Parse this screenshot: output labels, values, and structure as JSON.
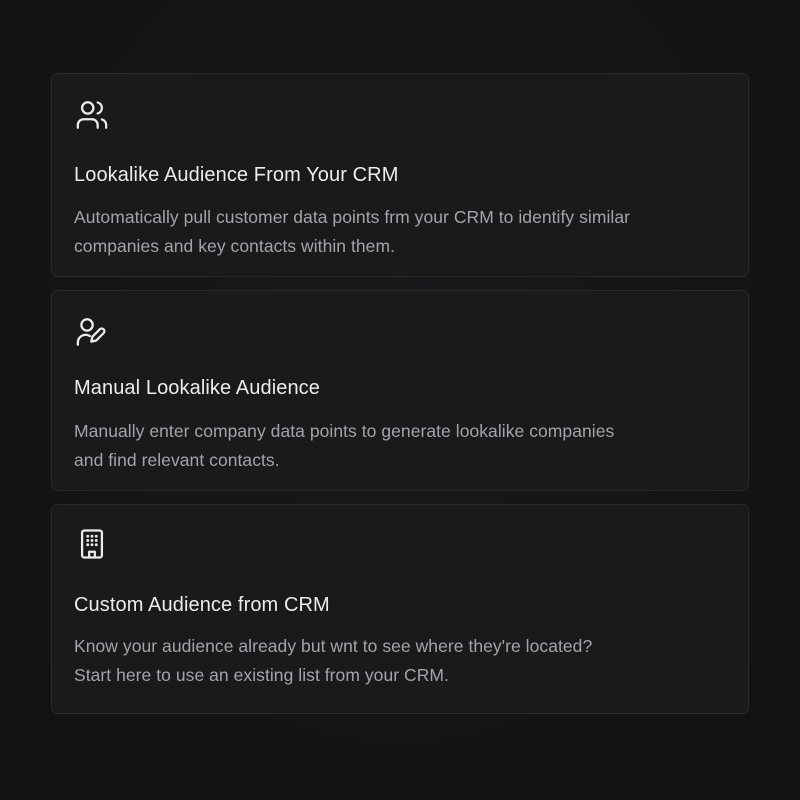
{
  "audience_options": [
    {
      "icon": "users-icon",
      "title": "Lookalike Audience From Your CRM",
      "description_lines": [
        "Automatically pull customer data points frm your CRM to identify similar",
        "companies and key contacts within them."
      ]
    },
    {
      "icon": "user-pen-icon",
      "title": "Manual Lookalike Audience",
      "description_lines": [
        "Manually enter company data points to generate lookalike companies",
        "and find relevant contacts."
      ]
    },
    {
      "icon": "building-icon",
      "title": "Custom Audience from CRM",
      "description_lines": [
        "Know your audience already but wnt to see where they're located?",
        "Start here to use an existing list from your CRM."
      ]
    }
  ],
  "colors": {
    "background": "#141416",
    "card_background": "#1a1a1d",
    "card_border": "#2a2a2e",
    "title_text": "#ececee",
    "description_text": "#a3a3aa",
    "icon_stroke": "#ececee"
  }
}
